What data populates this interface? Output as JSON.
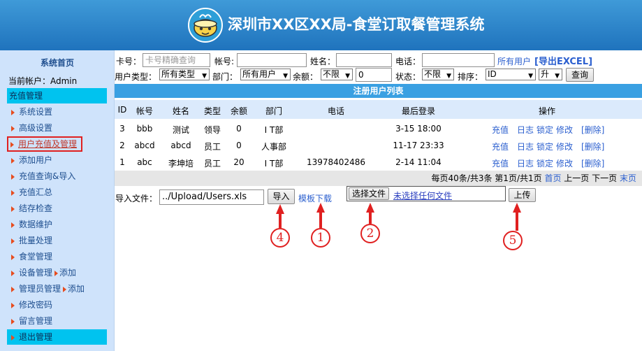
{
  "header": {
    "title": "深圳市XX区XX局-食堂订取餐管理系统"
  },
  "sidebar": {
    "home": "系统首页",
    "account": "当前帐户：Admin",
    "section_recharge": "充值管理",
    "items": [
      "系统设置",
      "高级设置",
      "用户充值及管理",
      "添加用户",
      "充值查询&导入",
      "充值汇总",
      "结存检查",
      "数据维护",
      "批量处理",
      "食堂管理",
      "设备管理",
      "管理员管理",
      "修改密码",
      "留言管理"
    ],
    "add_label": "添加",
    "logout": "退出管理"
  },
  "filters": {
    "card_label": "卡号：",
    "card_placeholder": "卡号精确查询",
    "account_label": "帐号:",
    "name_label": "姓名：",
    "phone_label": "电话：",
    "all_users_link": "所有用户",
    "export_link": "[导出EXCEL]",
    "usertype_label": "用户类型：",
    "usertype_value": "所有类型",
    "dept_label": "部门：",
    "dept_value": "所有用户",
    "balance_label": "余额：",
    "balance_op": "不限",
    "balance_value": "0",
    "status_label": "状态：",
    "status_value": "不限",
    "sort_label": "排序：",
    "sort_value": "ID",
    "order_value": "升",
    "query_button": "查询"
  },
  "table": {
    "title": "注册用户列表",
    "headers": [
      "ID",
      "帐号",
      "姓名",
      "类型",
      "余额",
      "部门",
      "电话",
      "最后登录",
      "操作"
    ],
    "rows": [
      {
        "id": "3",
        "account": "bbb",
        "name": "测试",
        "type": "领导",
        "balance": "0",
        "dept": "I T部",
        "phone": "",
        "last_login": "3-15 18:00"
      },
      {
        "id": "2",
        "account": "abcd",
        "name": "abcd",
        "type": "员工",
        "balance": "0",
        "dept": "人事部",
        "phone": "",
        "last_login": "11-17 23:33"
      },
      {
        "id": "1",
        "account": "abc",
        "name": "李坤培",
        "type": "员工",
        "balance": "20",
        "dept": "I T部",
        "phone": "13978402486",
        "last_login": "2-14 11:04"
      }
    ],
    "actions": {
      "recharge": "充值",
      "log": "日志",
      "lock": "锁定",
      "edit": "修改",
      "delete": "[删除]"
    }
  },
  "pager": {
    "summary": "每页40条/共3条 第1页/共1页",
    "first": "首页",
    "prev": "上一页",
    "next": "下一页",
    "last": "末页"
  },
  "import": {
    "label": "导入文件：",
    "path_value": "../Upload/Users.xls",
    "import_button": "导入",
    "template_link": "模板下载",
    "choose_button": "选择文件",
    "no_file_text": "未选择任何文件",
    "upload_button": "上传"
  },
  "annotations": [
    "4",
    "1",
    "2",
    "5"
  ],
  "colors": {
    "header_bg": "#1f73bd",
    "sidebar_bg": "#cfe3fb",
    "section_bg": "#00c3ef",
    "table_head": "#3aa0e2",
    "link": "#2b5fcf",
    "annotation": "#e02020"
  }
}
